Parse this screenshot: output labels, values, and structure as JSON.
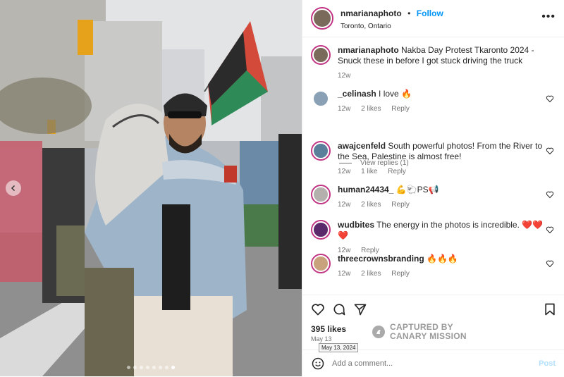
{
  "post_author": {
    "username": "nmarianaphoto",
    "follow_label": "Follow",
    "separator": "•",
    "location": "Toronto, Ontario"
  },
  "caption": {
    "username": "nmarianaphoto",
    "text": "Nakba Day Protest Tkaronto 2024 - Snuck these in before I got stuck driving the truck",
    "time": "12w"
  },
  "comments": [
    {
      "username": "_celinash",
      "text": "I love 🔥",
      "time": "12w",
      "likes": "2 likes",
      "reply": "Reply"
    },
    {
      "username": "awajcenfeld",
      "text": "South powerful photos! From the River to the Sea, Palestine is almost free!",
      "time": "12w",
      "likes": "1 like",
      "reply": "Reply"
    },
    {
      "username": "human24434_",
      "text": "💪🐑PS📢",
      "time": "12w",
      "likes": "2 likes",
      "reply": "Reply"
    },
    {
      "username": "wudbites",
      "text": "The energy in the photos is incredible. ❤️❤️❤️",
      "time": "12w",
      "likes": "",
      "reply": "Reply"
    },
    {
      "username": "threecrownsbranding",
      "text": "🔥🔥🔥",
      "time": "12w",
      "likes": "2 likes",
      "reply": "Reply"
    }
  ],
  "view_replies": "View replies (1)",
  "likes_count": "395 likes",
  "post_date": "May 13",
  "date_tooltip": "May 13, 2024",
  "watermark": {
    "line1": "CAPTURED BY",
    "line2": "CANARY MISSION"
  },
  "add_comment": {
    "placeholder": "Add a comment...",
    "post_label": "Post"
  },
  "icons": {
    "like": "heart-icon",
    "comment": "comment-icon",
    "share": "send-icon",
    "save": "bookmark-icon",
    "emoji": "emoji-icon",
    "more": "more-options-icon",
    "prev": "chevron-left-icon"
  },
  "colors": {
    "follow": "#0095f6",
    "muted": "#737373",
    "post_disabled": "#b2dffc",
    "avatar_ring": "#c13584"
  },
  "carousel": {
    "total": 8,
    "active": 8
  }
}
